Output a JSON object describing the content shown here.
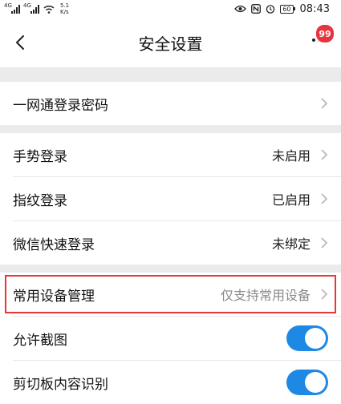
{
  "status": {
    "signal1": "4G",
    "signal2": "4G",
    "speed_value": "5.1",
    "speed_unit": "K/s",
    "battery": "60",
    "time": "08:43"
  },
  "header": {
    "title": "安全设置",
    "badge": "99"
  },
  "sections": [
    {
      "items": [
        {
          "label": "一网通登录密码",
          "value": ""
        }
      ]
    },
    {
      "items": [
        {
          "label": "手势登录",
          "value": "未启用"
        },
        {
          "label": "指纹登录",
          "value": "已启用"
        },
        {
          "label": "微信快速登录",
          "value": "未绑定"
        }
      ]
    },
    {
      "items": [
        {
          "label": "常用设备管理",
          "value": "仅支持常用设备"
        },
        {
          "label": "允许截图",
          "toggle": true
        },
        {
          "label": "剪切板内容识别",
          "toggle": true
        }
      ]
    }
  ],
  "colors": {
    "accent": "#1e88e5",
    "highlight": "#e53935",
    "badge": "#e8333c"
  }
}
